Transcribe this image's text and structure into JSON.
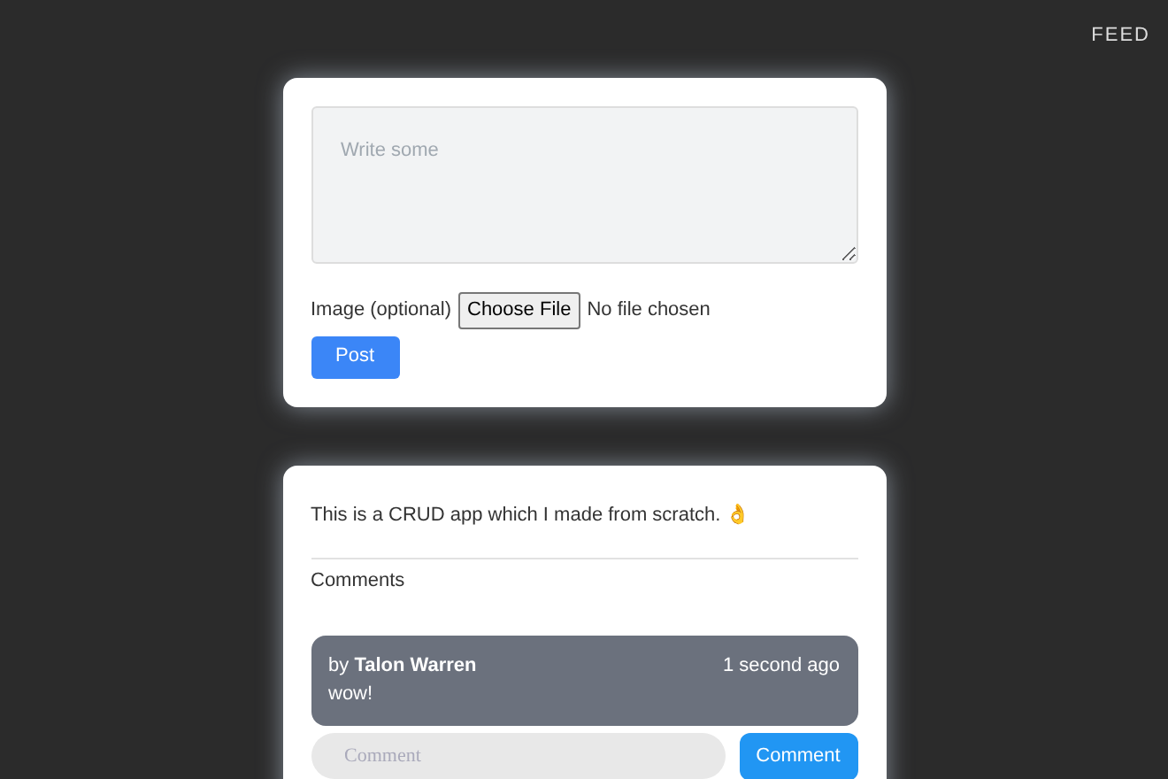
{
  "nav": {
    "link": "FEED"
  },
  "composer": {
    "placeholder": "Write some",
    "image_label": "Image (optional)",
    "file_button": "Choose File",
    "file_status": "No file chosen",
    "submit": "Post"
  },
  "post": {
    "text": "This is a CRUD app which I made from scratch. 👌",
    "comments_heading": "Comments",
    "comments": [
      {
        "by": "by ",
        "author": "Talon Warren",
        "time": "1 second ago",
        "text": "wow!"
      }
    ],
    "comment_input": {
      "placeholder": "Comment"
    },
    "comment_button": "Comment"
  }
}
